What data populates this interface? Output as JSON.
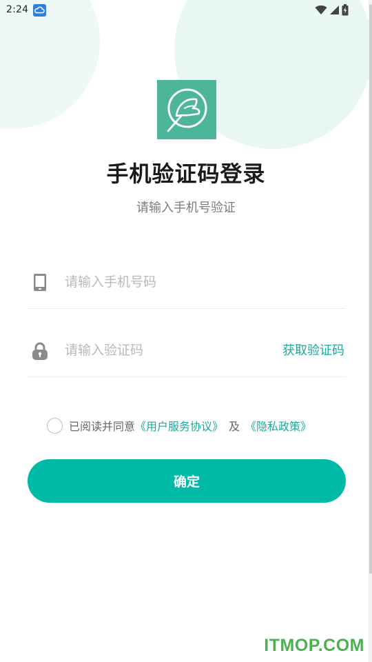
{
  "status_bar": {
    "time": "2:24",
    "icons": [
      "cloud-icon",
      "wifi-icon",
      "cellular-signal-icon",
      "battery-charging-icon"
    ]
  },
  "logo": {
    "icon": "bird-leaf-logo",
    "background": "#4db59a"
  },
  "header": {
    "title": "手机验证码登录",
    "subtitle": "请输入手机号验证"
  },
  "form": {
    "phone": {
      "icon": "phone-icon",
      "placeholder": "请输入手机号码",
      "value": ""
    },
    "code": {
      "icon": "lock-icon",
      "placeholder": "请输入验证码",
      "value": "",
      "get_code_label": "获取验证码"
    }
  },
  "agreement": {
    "checked": false,
    "prefix": "已阅读并同意",
    "user_agreement": "《用户服务协议》",
    "conjunction": "及",
    "privacy_policy": "《隐私政策》"
  },
  "confirm_button": {
    "label": "确定"
  },
  "watermark": "ITMOP.COM",
  "colors": {
    "accent": "#00b9a7",
    "link": "#1aa99a",
    "logo": "#4db59a",
    "watermark": "#4caf50"
  }
}
